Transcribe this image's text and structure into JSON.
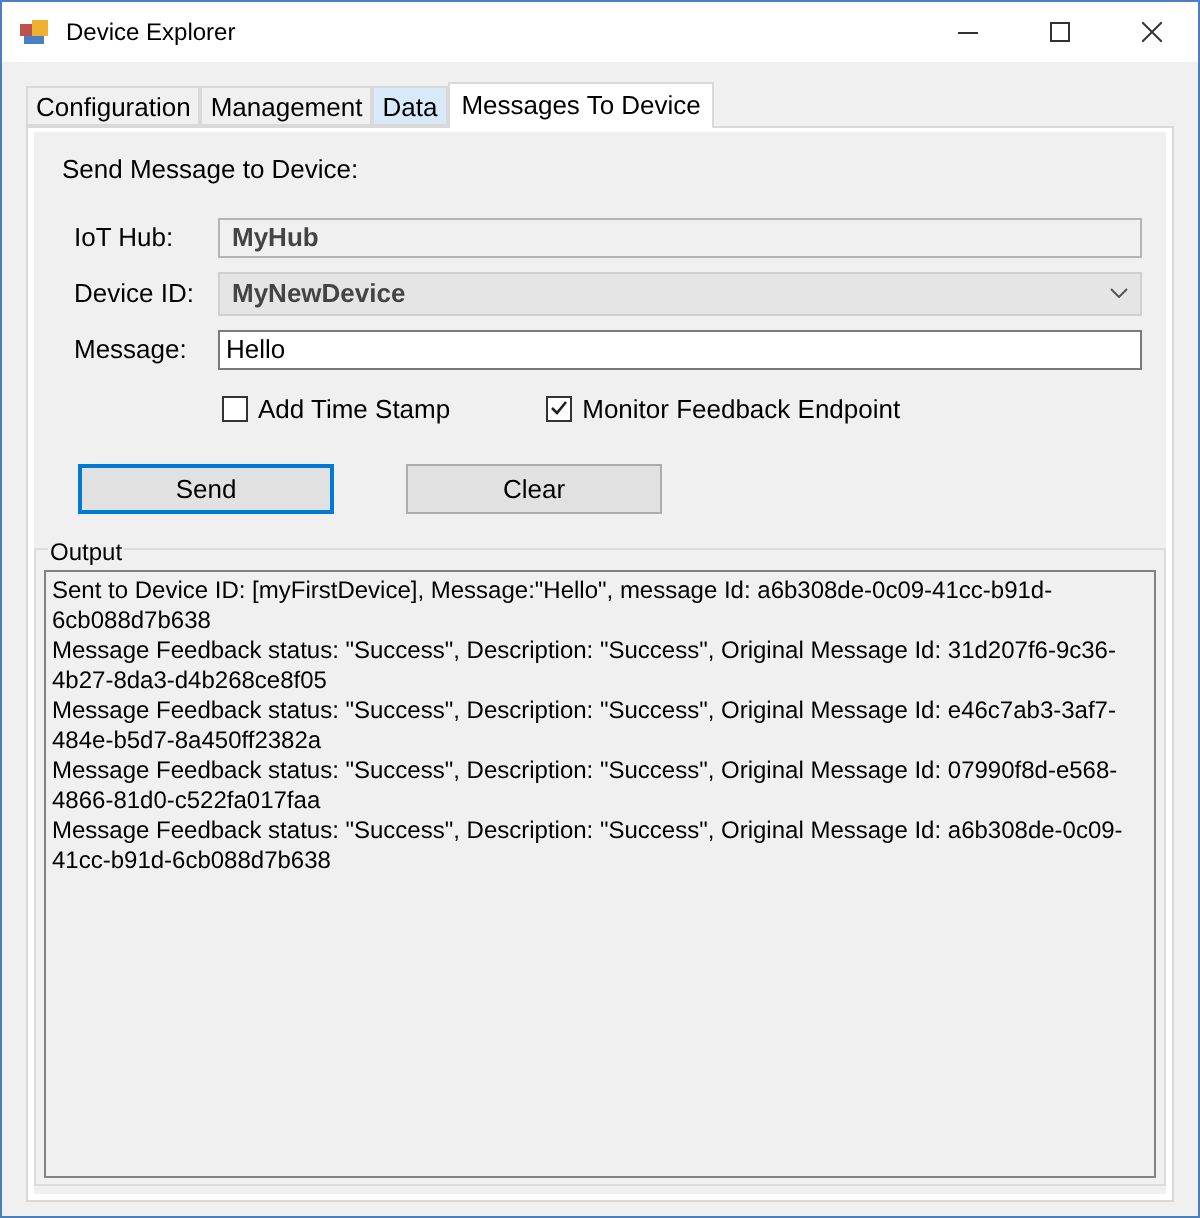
{
  "window": {
    "title": "Device Explorer"
  },
  "tabs": [
    {
      "label": "Configuration",
      "selected": false,
      "hovered": false
    },
    {
      "label": "Management",
      "selected": false,
      "hovered": false
    },
    {
      "label": "Data",
      "selected": false,
      "hovered": true
    },
    {
      "label": "Messages To Device",
      "selected": true,
      "hovered": false
    }
  ],
  "heading": "Send Message to Device:",
  "fields": [
    {
      "kind": "readonly",
      "label": "IoT Hub:",
      "value": "MyHub"
    },
    {
      "kind": "dropdown",
      "label": "Device ID:",
      "value": "MyNewDevice"
    },
    {
      "kind": "text",
      "label": "Message:",
      "value": "Hello"
    }
  ],
  "checkboxes": [
    {
      "label": "Add Time Stamp",
      "checked": false
    },
    {
      "label": "Monitor Feedback Endpoint",
      "checked": true
    }
  ],
  "buttons": [
    {
      "label": "Send",
      "selected": true
    },
    {
      "label": "Clear",
      "selected": false
    }
  ],
  "output": {
    "title": "Output",
    "lines": [
      "Sent to Device ID: [myFirstDevice], Message:\"Hello\", message Id: a6b308de-0c09-41cc-b91d-6cb088d7b638",
      "Message Feedback status: \"Success\", Description: \"Success\", Original Message Id: 31d207f6-9c36-4b27-8da3-d4b268ce8f05",
      "Message Feedback status: \"Success\", Description: \"Success\", Original Message Id: e46c7ab3-3af7-484e-b5d7-8a450ff2382a",
      "Message Feedback status: \"Success\", Description: \"Success\", Original Message Id: 07990f8d-e568-4866-81d0-c522fa017faa",
      "Message Feedback status: \"Success\", Description: \"Success\", Original Message Id: a6b308de-0c09-41cc-b91d-6cb088d7b638"
    ]
  }
}
